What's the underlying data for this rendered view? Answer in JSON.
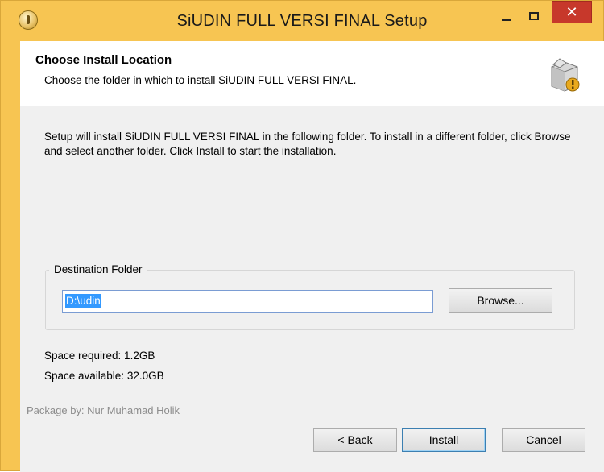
{
  "window": {
    "title": "SiUDIN FULL VERSI FINAL Setup",
    "close_glyph": "✕",
    "accent_color": "#f7c552",
    "close_color": "#c7382b"
  },
  "header": {
    "title": "Choose Install Location",
    "subtitle": "Choose the folder in which to install SiUDIN FULL VERSI FINAL.",
    "icon": "installer-box-icon"
  },
  "body": {
    "intro": "Setup will install SiUDIN FULL VERSI FINAL in the following folder. To install in a different folder, click Browse and select another folder. Click Install to start the installation."
  },
  "destination": {
    "group_label": "Destination Folder",
    "path_value": "D:\\udin",
    "browse_label": "Browse..."
  },
  "space": {
    "required": "Space required: 1.2GB",
    "available": "Space available: 32.0GB"
  },
  "branding": "Package by: Nur Muhamad Holik",
  "buttons": {
    "back": "< Back",
    "install": "Install",
    "cancel": "Cancel"
  }
}
